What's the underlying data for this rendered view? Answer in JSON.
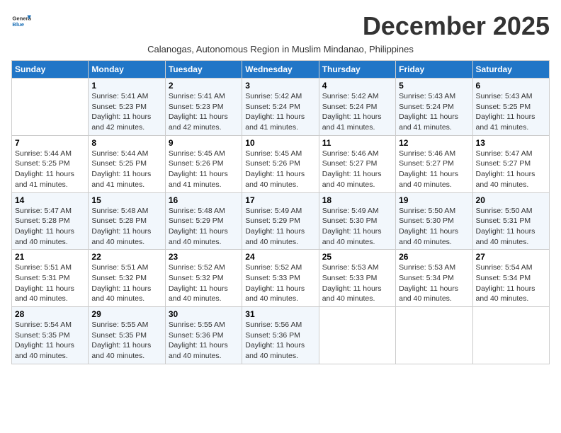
{
  "logo": {
    "general": "General",
    "blue": "Blue"
  },
  "title": "December 2025",
  "subtitle": "Calanogas, Autonomous Region in Muslim Mindanao, Philippines",
  "headers": [
    "Sunday",
    "Monday",
    "Tuesday",
    "Wednesday",
    "Thursday",
    "Friday",
    "Saturday"
  ],
  "weeks": [
    [
      {
        "day": "",
        "sunrise": "",
        "sunset": "",
        "daylight": ""
      },
      {
        "day": "1",
        "sunrise": "Sunrise: 5:41 AM",
        "sunset": "Sunset: 5:23 PM",
        "daylight": "Daylight: 11 hours and 42 minutes."
      },
      {
        "day": "2",
        "sunrise": "Sunrise: 5:41 AM",
        "sunset": "Sunset: 5:23 PM",
        "daylight": "Daylight: 11 hours and 42 minutes."
      },
      {
        "day": "3",
        "sunrise": "Sunrise: 5:42 AM",
        "sunset": "Sunset: 5:24 PM",
        "daylight": "Daylight: 11 hours and 41 minutes."
      },
      {
        "day": "4",
        "sunrise": "Sunrise: 5:42 AM",
        "sunset": "Sunset: 5:24 PM",
        "daylight": "Daylight: 11 hours and 41 minutes."
      },
      {
        "day": "5",
        "sunrise": "Sunrise: 5:43 AM",
        "sunset": "Sunset: 5:24 PM",
        "daylight": "Daylight: 11 hours and 41 minutes."
      },
      {
        "day": "6",
        "sunrise": "Sunrise: 5:43 AM",
        "sunset": "Sunset: 5:25 PM",
        "daylight": "Daylight: 11 hours and 41 minutes."
      }
    ],
    [
      {
        "day": "7",
        "sunrise": "Sunrise: 5:44 AM",
        "sunset": "Sunset: 5:25 PM",
        "daylight": "Daylight: 11 hours and 41 minutes."
      },
      {
        "day": "8",
        "sunrise": "Sunrise: 5:44 AM",
        "sunset": "Sunset: 5:25 PM",
        "daylight": "Daylight: 11 hours and 41 minutes."
      },
      {
        "day": "9",
        "sunrise": "Sunrise: 5:45 AM",
        "sunset": "Sunset: 5:26 PM",
        "daylight": "Daylight: 11 hours and 41 minutes."
      },
      {
        "day": "10",
        "sunrise": "Sunrise: 5:45 AM",
        "sunset": "Sunset: 5:26 PM",
        "daylight": "Daylight: 11 hours and 40 minutes."
      },
      {
        "day": "11",
        "sunrise": "Sunrise: 5:46 AM",
        "sunset": "Sunset: 5:27 PM",
        "daylight": "Daylight: 11 hours and 40 minutes."
      },
      {
        "day": "12",
        "sunrise": "Sunrise: 5:46 AM",
        "sunset": "Sunset: 5:27 PM",
        "daylight": "Daylight: 11 hours and 40 minutes."
      },
      {
        "day": "13",
        "sunrise": "Sunrise: 5:47 AM",
        "sunset": "Sunset: 5:27 PM",
        "daylight": "Daylight: 11 hours and 40 minutes."
      }
    ],
    [
      {
        "day": "14",
        "sunrise": "Sunrise: 5:47 AM",
        "sunset": "Sunset: 5:28 PM",
        "daylight": "Daylight: 11 hours and 40 minutes."
      },
      {
        "day": "15",
        "sunrise": "Sunrise: 5:48 AM",
        "sunset": "Sunset: 5:28 PM",
        "daylight": "Daylight: 11 hours and 40 minutes."
      },
      {
        "day": "16",
        "sunrise": "Sunrise: 5:48 AM",
        "sunset": "Sunset: 5:29 PM",
        "daylight": "Daylight: 11 hours and 40 minutes."
      },
      {
        "day": "17",
        "sunrise": "Sunrise: 5:49 AM",
        "sunset": "Sunset: 5:29 PM",
        "daylight": "Daylight: 11 hours and 40 minutes."
      },
      {
        "day": "18",
        "sunrise": "Sunrise: 5:49 AM",
        "sunset": "Sunset: 5:30 PM",
        "daylight": "Daylight: 11 hours and 40 minutes."
      },
      {
        "day": "19",
        "sunrise": "Sunrise: 5:50 AM",
        "sunset": "Sunset: 5:30 PM",
        "daylight": "Daylight: 11 hours and 40 minutes."
      },
      {
        "day": "20",
        "sunrise": "Sunrise: 5:50 AM",
        "sunset": "Sunset: 5:31 PM",
        "daylight": "Daylight: 11 hours and 40 minutes."
      }
    ],
    [
      {
        "day": "21",
        "sunrise": "Sunrise: 5:51 AM",
        "sunset": "Sunset: 5:31 PM",
        "daylight": "Daylight: 11 hours and 40 minutes."
      },
      {
        "day": "22",
        "sunrise": "Sunrise: 5:51 AM",
        "sunset": "Sunset: 5:32 PM",
        "daylight": "Daylight: 11 hours and 40 minutes."
      },
      {
        "day": "23",
        "sunrise": "Sunrise: 5:52 AM",
        "sunset": "Sunset: 5:32 PM",
        "daylight": "Daylight: 11 hours and 40 minutes."
      },
      {
        "day": "24",
        "sunrise": "Sunrise: 5:52 AM",
        "sunset": "Sunset: 5:33 PM",
        "daylight": "Daylight: 11 hours and 40 minutes."
      },
      {
        "day": "25",
        "sunrise": "Sunrise: 5:53 AM",
        "sunset": "Sunset: 5:33 PM",
        "daylight": "Daylight: 11 hours and 40 minutes."
      },
      {
        "day": "26",
        "sunrise": "Sunrise: 5:53 AM",
        "sunset": "Sunset: 5:34 PM",
        "daylight": "Daylight: 11 hours and 40 minutes."
      },
      {
        "day": "27",
        "sunrise": "Sunrise: 5:54 AM",
        "sunset": "Sunset: 5:34 PM",
        "daylight": "Daylight: 11 hours and 40 minutes."
      }
    ],
    [
      {
        "day": "28",
        "sunrise": "Sunrise: 5:54 AM",
        "sunset": "Sunset: 5:35 PM",
        "daylight": "Daylight: 11 hours and 40 minutes."
      },
      {
        "day": "29",
        "sunrise": "Sunrise: 5:55 AM",
        "sunset": "Sunset: 5:35 PM",
        "daylight": "Daylight: 11 hours and 40 minutes."
      },
      {
        "day": "30",
        "sunrise": "Sunrise: 5:55 AM",
        "sunset": "Sunset: 5:36 PM",
        "daylight": "Daylight: 11 hours and 40 minutes."
      },
      {
        "day": "31",
        "sunrise": "Sunrise: 5:56 AM",
        "sunset": "Sunset: 5:36 PM",
        "daylight": "Daylight: 11 hours and 40 minutes."
      },
      {
        "day": "",
        "sunrise": "",
        "sunset": "",
        "daylight": ""
      },
      {
        "day": "",
        "sunrise": "",
        "sunset": "",
        "daylight": ""
      },
      {
        "day": "",
        "sunrise": "",
        "sunset": "",
        "daylight": ""
      }
    ]
  ]
}
